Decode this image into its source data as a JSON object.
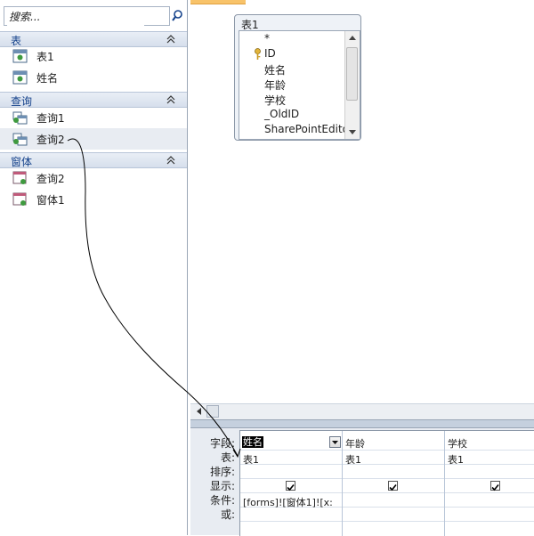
{
  "nav": {
    "search_placeholder": "搜索...",
    "groups": [
      {
        "title": "表",
        "items": [
          "表1",
          "姓名"
        ]
      },
      {
        "title": "查询",
        "items": [
          "查询1",
          "查询2"
        ]
      },
      {
        "title": "窗体",
        "items": [
          "查询2",
          "窗体1"
        ]
      }
    ],
    "selected_item": "查询2"
  },
  "design": {
    "table_title": "表1",
    "fields": [
      "*",
      "ID",
      "姓名",
      "年龄",
      "学校",
      "_OldID",
      "SharePointEdito"
    ]
  },
  "grid": {
    "row_labels": [
      "字段:",
      "表:",
      "排序:",
      "显示:",
      "条件:",
      "或:"
    ],
    "columns": [
      {
        "field": "姓名",
        "table": "表1",
        "show": true,
        "criteria": "[forms]![窗体1]![x:"
      },
      {
        "field": "年龄",
        "table": "表1",
        "show": true,
        "criteria": ""
      },
      {
        "field": "学校",
        "table": "表1",
        "show": true,
        "criteria": ""
      }
    ]
  },
  "colors": {
    "accent_header": "#15428b",
    "annotation_line": "#000000"
  }
}
